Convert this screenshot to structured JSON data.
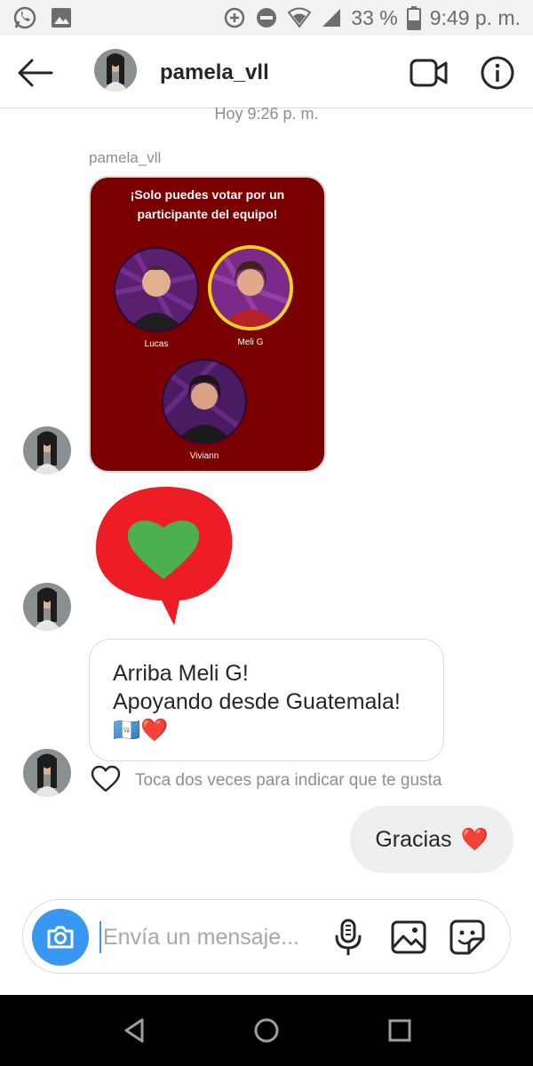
{
  "status_bar": {
    "battery": "33 %",
    "time": "9:49 p. m.",
    "icons": [
      "whatsapp-icon",
      "gallery-icon",
      "data-saver-icon",
      "do-not-disturb-icon",
      "wifi-icon",
      "signal-icon",
      "battery-icon"
    ]
  },
  "header": {
    "username": "pamela_vll",
    "icons": [
      "back-arrow-icon",
      "video-call-icon",
      "info-icon"
    ]
  },
  "conversation": {
    "timestamp": "Hoy 9:26 p. m.",
    "sender_label": "pamela_vll",
    "poll": {
      "title": "¡Solo puedes votar por un participante del equipo!",
      "background": "#7a0000",
      "highlight": "#f2d21b",
      "candidates": [
        {
          "name": "Lucas",
          "selected": false
        },
        {
          "name": "Meli G",
          "selected": true
        },
        {
          "name": "Viviann",
          "selected": false
        }
      ]
    },
    "sticker": {
      "icon": "green-heart-speech-bubble-icon",
      "bubble_color": "#ee1c25",
      "heart_color": "#4caf50"
    },
    "message": {
      "line1": "Arriba Meli G!",
      "line2": "Apoyando desde Guatemala!",
      "emoji": "🇬🇹❤️"
    },
    "like_hint": "Toca dos veces para indicar que te gusta",
    "sent_message": {
      "text": "Gracias",
      "emoji": "❤️"
    }
  },
  "composer": {
    "placeholder": "Envía un mensaje...",
    "accent": "#3897f0",
    "icons": [
      "camera-icon",
      "microphone-icon",
      "image-icon",
      "sticker-icon"
    ]
  },
  "nav_bar": {
    "icons": [
      "nav-back-icon",
      "nav-home-icon",
      "nav-recents-icon"
    ]
  }
}
